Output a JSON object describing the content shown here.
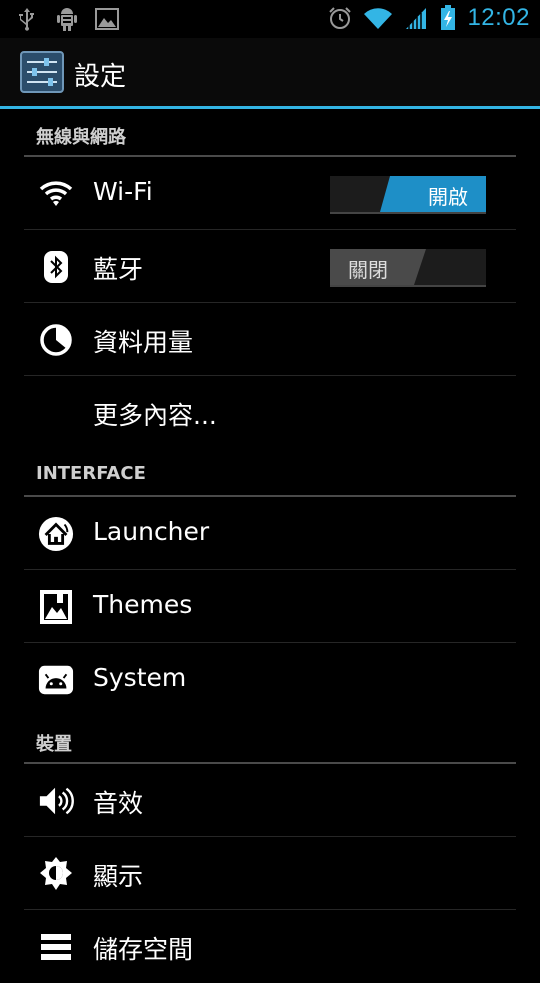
{
  "status": {
    "time": "12:02"
  },
  "app": {
    "title": "設定"
  },
  "sections": [
    {
      "label": "無線與網路"
    },
    {
      "label": "INTERFACE"
    },
    {
      "label": "裝置"
    }
  ],
  "items": {
    "wifi": {
      "label": "Wi-Fi",
      "toggle": "開啟"
    },
    "bluetooth": {
      "label": "藍牙",
      "toggle": "關閉"
    },
    "data_usage": {
      "label": "資料用量"
    },
    "more": {
      "label": "更多內容..."
    },
    "launcher": {
      "label": "Launcher"
    },
    "themes": {
      "label": "Themes"
    },
    "system": {
      "label": "System"
    },
    "sound": {
      "label": "音效"
    },
    "display": {
      "label": "顯示"
    },
    "storage": {
      "label": "儲存空間"
    }
  },
  "colors": {
    "accent": "#33b5e5",
    "toggle_on": "#1e8fc7"
  }
}
